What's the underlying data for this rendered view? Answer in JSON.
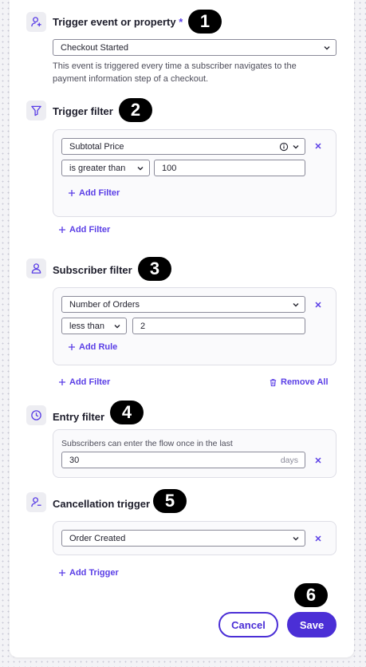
{
  "trigger": {
    "title": "Trigger event or property",
    "required_mark": "*",
    "badge": "1",
    "selected": "Checkout Started",
    "description": "This event is triggered every time a subscriber navigates to the payment information step of a checkout."
  },
  "trigger_filter": {
    "title": "Trigger filter",
    "badge": "2",
    "property": "Subtotal Price",
    "operator": "is greater than",
    "value": "100",
    "add_filter_inner": "Add Filter",
    "add_filter": "Add Filter"
  },
  "subscriber_filter": {
    "title": "Subscriber filter",
    "badge": "3",
    "property": "Number of Orders",
    "operator": "less than",
    "value": "2",
    "add_rule": "Add Rule",
    "add_filter": "Add Filter",
    "remove_all": "Remove All"
  },
  "entry_filter": {
    "title": "Entry filter",
    "badge": "4",
    "label": "Subscribers can enter the flow once in the last",
    "value": "30",
    "unit": "days"
  },
  "cancellation": {
    "title": "Cancellation trigger",
    "badge": "5",
    "selected": "Order Created",
    "add_trigger": "Add Trigger"
  },
  "footer": {
    "badge": "6",
    "cancel": "Cancel",
    "save": "Save"
  },
  "colors": {
    "accent": "#4b2fd6",
    "link": "#5a3ee6",
    "border": "#8a8a99"
  }
}
